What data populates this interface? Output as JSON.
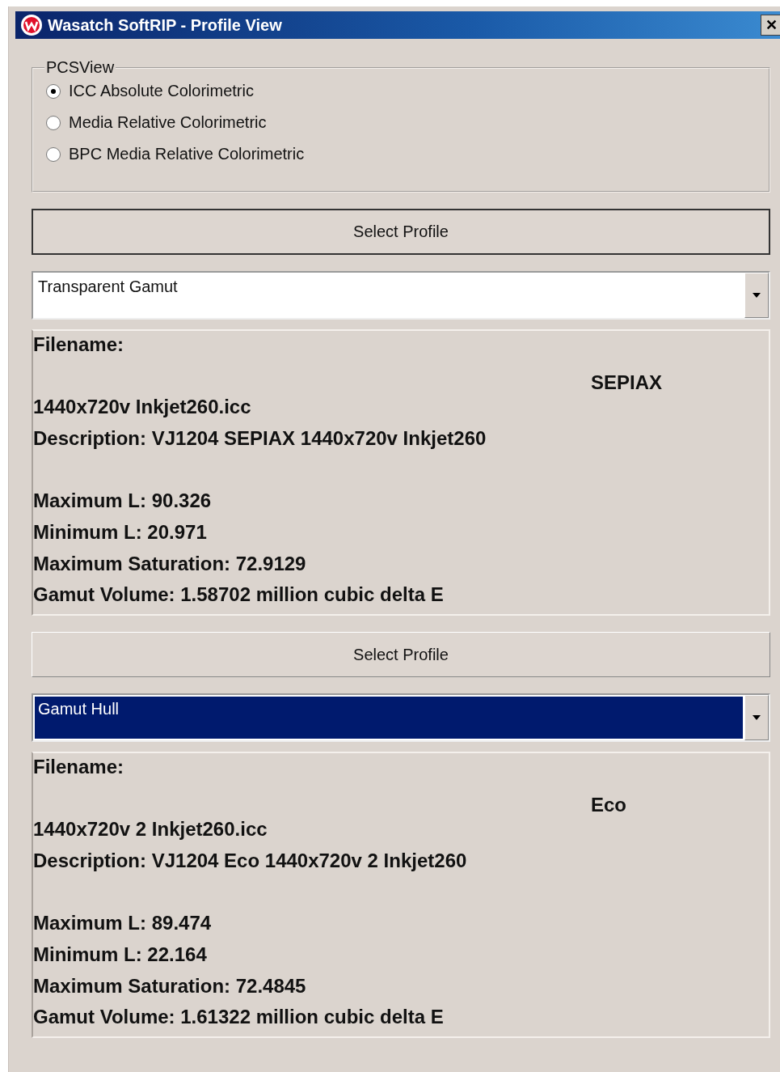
{
  "window": {
    "title": "Wasatch SoftRIP - Profile View",
    "close": "✕"
  },
  "pcs_view": {
    "title": "PCSView",
    "options": [
      {
        "label": "ICC Absolute Colorimetric",
        "selected": true
      },
      {
        "label": "Media Relative Colorimetric",
        "selected": false
      },
      {
        "label": "BPC Media Relative Colorimetric",
        "selected": false
      }
    ]
  },
  "panels": [
    {
      "button": "Select Profile",
      "dropdown": {
        "value": "Transparent Gamut",
        "highlighted": false
      },
      "info": {
        "filename_label": "Filename:",
        "name": "SEPIAX",
        "filename": "1440x720v Inkjet260.icc",
        "description": "Description: VJ1204 SEPIAX 1440x720v Inkjet260",
        "stats": [
          "Maximum L: 90.326",
          "Minimum L: 20.971",
          "Maximum Saturation: 72.9129",
          "Gamut Volume: 1.58702 million cubic delta E"
        ]
      }
    },
    {
      "button": "Select Profile",
      "dropdown": {
        "value": "Gamut Hull",
        "highlighted": true
      },
      "info": {
        "filename_label": "Filename:",
        "name": "Eco",
        "filename": "1440x720v 2 Inkjet260.icc",
        "description": "Description: VJ1204 Eco 1440x720v 2 Inkjet260",
        "stats": [
          "Maximum L: 89.474",
          "Minimum L: 22.164",
          "Maximum Saturation: 72.4845",
          "Gamut Volume: 1.61322 million cubic delta E"
        ]
      }
    }
  ]
}
